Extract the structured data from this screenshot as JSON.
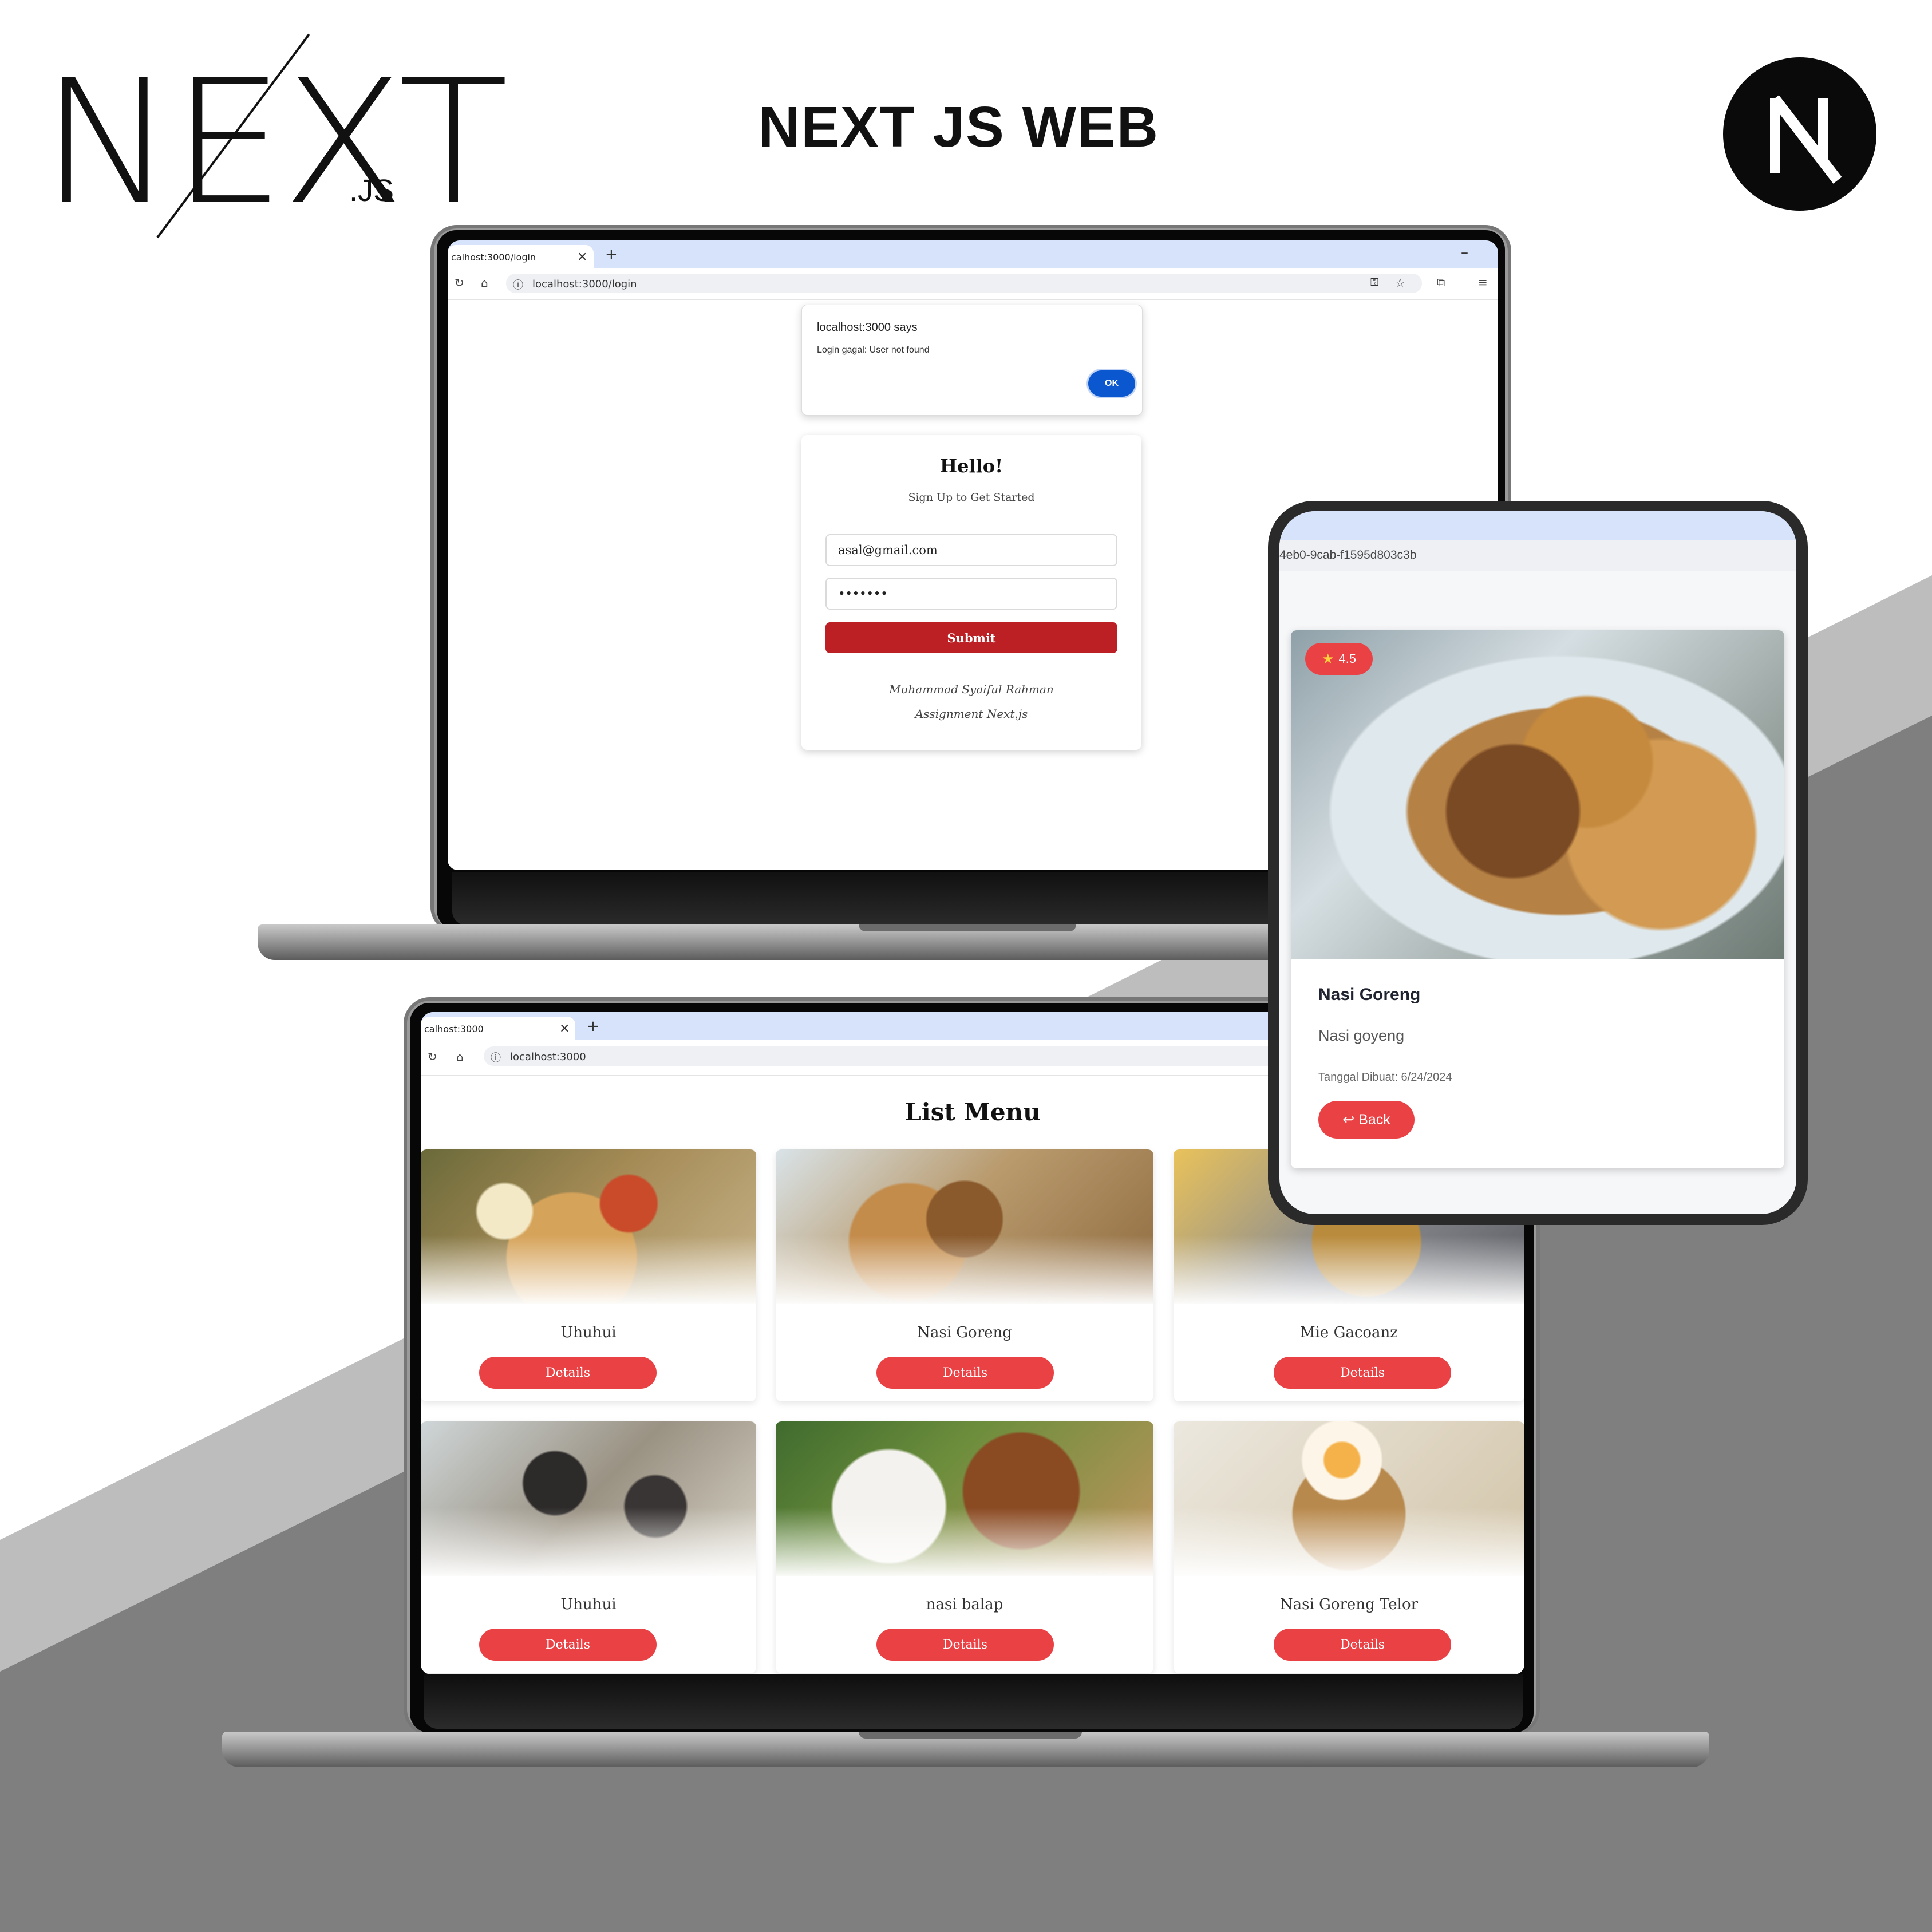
{
  "header": {
    "logo_main": "NEXT",
    "logo_suffix": ".JS",
    "title": "NEXT JS WEB",
    "badge_letter": "N"
  },
  "login_window": {
    "tab_title": "calhost:3000/login",
    "tab_close": "×",
    "new_tab": "+",
    "minimize": "–",
    "url": "localhost:3000/login",
    "dialog": {
      "title": "localhost:3000 says",
      "message": "Login gagal: User not found",
      "ok_label": "OK"
    },
    "form": {
      "heading": "Hello!",
      "subheading": "Sign Up to Get Started",
      "email_value": "asal@gmail.com",
      "password_value": "•••••••",
      "submit_label": "Submit",
      "author": "Muhammad Syaiful Rahman",
      "footer_note": "Assignment Next.js"
    }
  },
  "menu_window": {
    "tab_title": "calhost:3000",
    "tab_close": "×",
    "new_tab": "+",
    "url": "localhost:3000",
    "heading": "List Menu",
    "details_label": "Details",
    "items": [
      {
        "name": "Uhuhui"
      },
      {
        "name": "Nasi Goreng"
      },
      {
        "name": "Mie Gacoanz"
      },
      {
        "name": "Uhuhui"
      },
      {
        "name": "nasi balap"
      },
      {
        "name": "Nasi Goreng Telor"
      }
    ]
  },
  "detail_window": {
    "url_fragment": "4eb0-9cab-f1595d803c3b",
    "rating": "4.5",
    "dish_name": "Nasi Goreng",
    "description": "Nasi goyeng",
    "created_label": "Tanggal Dibuat: 6/24/2024",
    "back_label": "↩ Back"
  },
  "colors": {
    "accent_red": "#ea4145",
    "submit_red": "#bc1f24",
    "chrome_blue": "#d6e3fb",
    "dialog_ok_blue": "#0b57d0",
    "bg_light_grey": "#bdbdbd",
    "bg_dark_grey": "#7f7f7f"
  }
}
